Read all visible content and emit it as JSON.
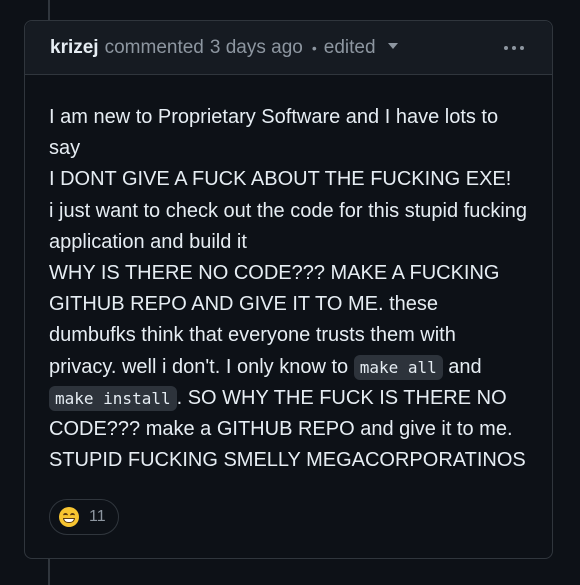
{
  "comment": {
    "author": "krizej",
    "action": "commented",
    "time": "3 days ago",
    "separator": "•",
    "edited": "edited",
    "body": {
      "line1": "I am new to Proprietary Software and I have lots to say",
      "line2": "I DONT GIVE A FUCK ABOUT THE FUCKING EXE!",
      "line3": "i just want to check out the code for this stupid fucking application and build it",
      "line4_text": "WHY IS THERE NO CODE??? MAKE A FUCKING GITHUB REPO AND GIVE IT TO ME. these dumbufks think that everyone trusts them with privacy. well i don't. I only know to ",
      "code1": "make all",
      "line4_mid": " and ",
      "code2": "make install",
      "line4_end": ". SO WHY THE FUCK IS THERE NO CODE??? make a GITHUB REPO and give it to me.",
      "line5": "STUPID FUCKING SMELLY MEGACORPORATINOS"
    },
    "reactions": [
      {
        "emoji": "grinning-face",
        "count": "11"
      }
    ]
  },
  "colors": {
    "background": "#0d1117",
    "border": "#30363d",
    "text": "#e6edf3",
    "muted": "#8d96a0"
  }
}
